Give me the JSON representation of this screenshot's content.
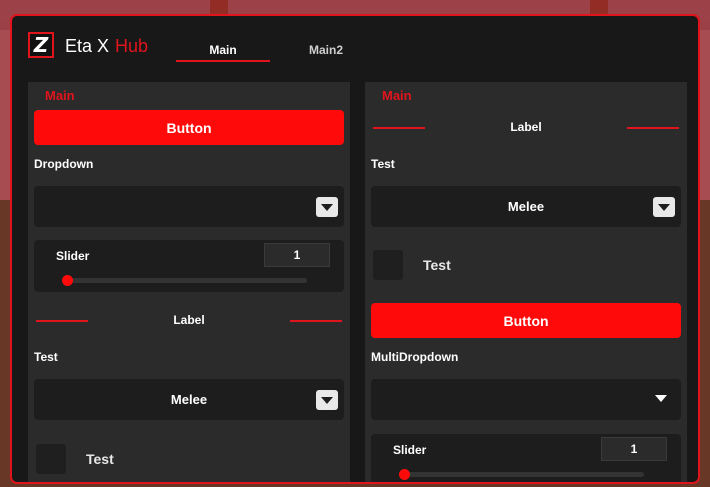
{
  "window": {
    "title": "Eta X",
    "title_accent": "Hub",
    "logo_letter": "Z",
    "accent_color": "#e0141c"
  },
  "tabs": [
    {
      "label": "Main",
      "active": true
    },
    {
      "label": "Main2",
      "active": false
    }
  ],
  "left": {
    "section_title": "Main",
    "button_label": "Button",
    "dropdown_label": "Dropdown",
    "dropdown_value": "",
    "slider": {
      "label": "Slider",
      "value": "1",
      "level": 0.0
    },
    "divider_label": "Label",
    "test_label": "Test",
    "test_dropdown_value": "Melee",
    "checkbox_label": "Test"
  },
  "right": {
    "section_title": "Main",
    "divider_label": "Label",
    "test_label": "Test",
    "test_dropdown_value": "Melee",
    "checkbox_label": "Test",
    "button_label": "Button",
    "multidropdown_label": "MultiDropdown",
    "multidropdown_value": "",
    "slider": {
      "label": "Slider",
      "value": "1",
      "level": 0.0
    }
  }
}
